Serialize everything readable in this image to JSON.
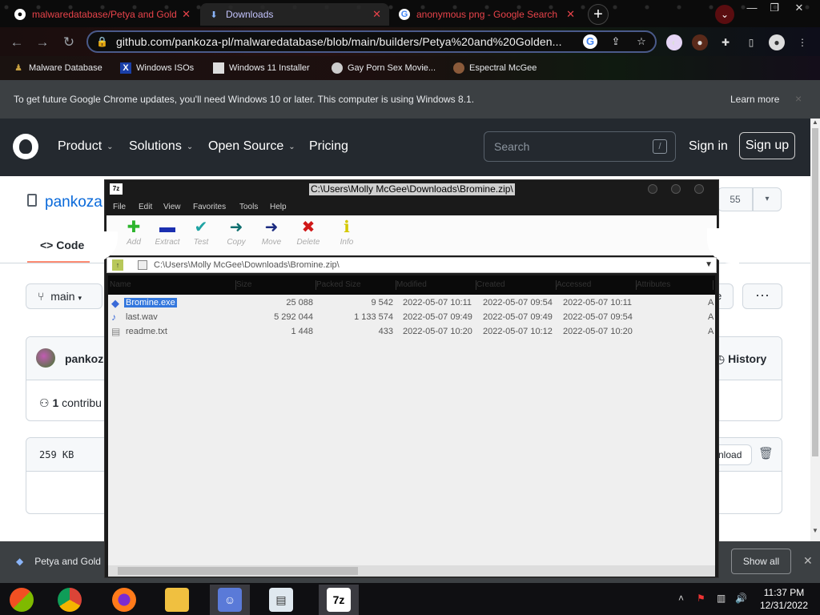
{
  "browser": {
    "tabs": [
      {
        "title": "malwaredatabase/Petya and Gold",
        "icon": "github-icon"
      },
      {
        "title": "Downloads",
        "icon": "download-icon"
      },
      {
        "title": "anonymous png - Google Search",
        "icon": "google-icon"
      }
    ],
    "new_tab_label": "+",
    "url": "github.com/pankoza-pl/malwaredatabase/blob/main/builders/Petya%20and%20Golden...",
    "bookmarks": [
      "Malware Database",
      "Windows ISOs",
      "Windows 11 Installer",
      "Gay Porn Sex Movie...",
      "Espectral McGee"
    ],
    "infobar": {
      "message": "To get future Google Chrome updates, you'll need Windows 10 or later. This computer is using Windows 8.1.",
      "learn_more": "Learn more",
      "close": "×"
    }
  },
  "github": {
    "nav": [
      "Product",
      "Solutions",
      "Open Source",
      "Pricing"
    ],
    "search_placeholder": "Search",
    "search_key": "/",
    "sign_in": "Sign in",
    "sign_up": "Sign up",
    "repo_owner": "pankoza",
    "star_count": "55",
    "code_tab": "Code",
    "branch": "main",
    "commit_user": "pankoz",
    "history": "History",
    "contributors_count": "1",
    "contributors_label": "contribu",
    "file_size": "259 KB",
    "download_fragment": "nload",
    "branch_side_fragment": "e"
  },
  "sevenzip": {
    "title": "C:\\Users\\Molly McGee\\Downloads\\Bromine.zip\\",
    "menu": [
      "File",
      "Edit",
      "View",
      "Favorites",
      "Tools",
      "Help"
    ],
    "tools": [
      {
        "label": "Add",
        "icon": "add-icon",
        "color": "#2db52d"
      },
      {
        "label": "Extract",
        "icon": "extract-icon",
        "color": "#1b2fb0"
      },
      {
        "label": "Test",
        "icon": "test-icon",
        "color": "#1fa3a3"
      },
      {
        "label": "Copy",
        "icon": "copy-icon",
        "color": "#0f6f6f"
      },
      {
        "label": "Move",
        "icon": "move-icon",
        "color": "#1b2b80"
      },
      {
        "label": "Delete",
        "icon": "delete-icon",
        "color": "#d01818"
      },
      {
        "label": "Info",
        "icon": "info-icon",
        "color": "#d4c800"
      }
    ],
    "address": "C:\\Users\\Molly McGee\\Downloads\\Bromine.zip\\",
    "columns": [
      "Name",
      "Size",
      "Packed Size",
      "Modified",
      "Created",
      "Accessed",
      "Attributes"
    ],
    "files": [
      {
        "name": "Bromine.exe",
        "size": "25 088",
        "packed": "9 542",
        "modified": "2022-05-07 10:11",
        "created": "2022-05-07 09:54",
        "accessed": "2022-05-07 10:11",
        "attr": "A",
        "icon": "exe-file-icon",
        "selected": true
      },
      {
        "name": "last.wav",
        "size": "5 292 044",
        "packed": "1 133 574",
        "modified": "2022-05-07 09:49",
        "created": "2022-05-07 09:49",
        "accessed": "2022-05-07 09:54",
        "attr": "A",
        "icon": "audio-file-icon",
        "selected": false
      },
      {
        "name": "readme.txt",
        "size": "1 448",
        "packed": "433",
        "modified": "2022-05-07 10:20",
        "created": "2022-05-07 10:12",
        "accessed": "2022-05-07 10:20",
        "attr": "A",
        "icon": "text-file-icon",
        "selected": false
      }
    ]
  },
  "downloads_shelf": {
    "item": "Petya and Gold",
    "show_all": "Show all"
  },
  "taskbar": {
    "apps": [
      "windows-start",
      "chrome",
      "firefox",
      "file-explorer",
      "people-app",
      "notepad-app",
      "7zip"
    ],
    "time": "11:37 PM",
    "date": "12/31/2022"
  }
}
